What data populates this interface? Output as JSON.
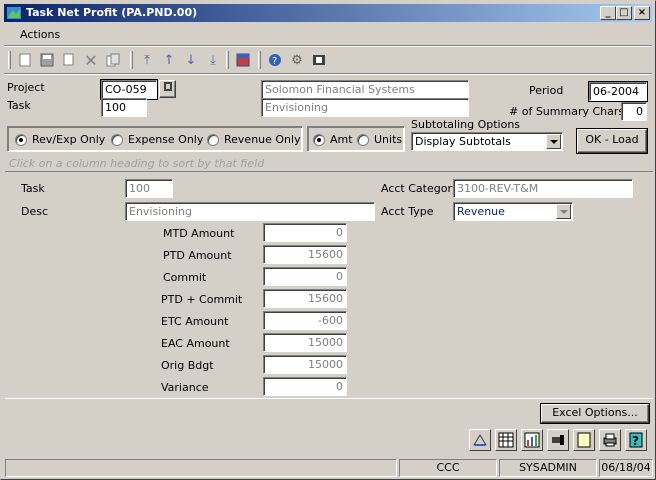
{
  "window": {
    "title": "Task Net Profit (PA.PND.00)"
  },
  "menu": {
    "actions_label": "Actions"
  },
  "toolbar": {
    "icons": [
      "new-icon",
      "save-icon",
      "copy-icon",
      "delete-icon",
      "cancel-icon",
      "first-icon",
      "previous-icon",
      "next-icon",
      "last-icon",
      "template-icon",
      "help-icon",
      "customize-icon",
      "quick-query-icon"
    ]
  },
  "header": {
    "project_label": "Project",
    "project_value": "CO-059",
    "project_desc": "Solomon Financial Systems",
    "task_label": "Task",
    "task_value": "100",
    "task_desc": "Envisioning",
    "period_label": "Period",
    "period_value": "06-2004",
    "summary_chars_label": "# of Summary Chars",
    "summary_chars_value": "0"
  },
  "options": {
    "radio_revexp": "Rev/Exp Only",
    "radio_expense": "Expense Only",
    "radio_revenue": "Revenue Only",
    "radio_amt": "Amt",
    "radio_units": "Units",
    "subtotaling_label": "Subtotaling Options",
    "subtotaling_value": "Display Subtotals",
    "ok_load": "OK - Load"
  },
  "hint": "Click on a column heading to sort by that field",
  "detail": {
    "task_label": "Task",
    "task_value": "100",
    "desc_label": "Desc",
    "desc_value": "Envisioning",
    "acct_category_label": "Acct Category",
    "acct_category_value": "3100-REV-T&M",
    "acct_type_label": "Acct Type",
    "acct_type_value": "Revenue",
    "amounts": [
      {
        "label": "MTD Amount",
        "value": "0"
      },
      {
        "label": "PTD Amount",
        "value": "15600"
      },
      {
        "label": "Commit",
        "value": "0"
      },
      {
        "label": "PTD + Commit",
        "value": "15600"
      },
      {
        "label": "ETC Amount",
        "value": "-600"
      },
      {
        "label": "EAC Amount",
        "value": "15000"
      },
      {
        "label": "Orig Bdgt",
        "value": "15000"
      },
      {
        "label": "Variance",
        "value": "0"
      }
    ]
  },
  "excel_options": "Excel Options...",
  "status": {
    "company": "CCC",
    "user": "SYSADMIN",
    "date": "06/18/04"
  }
}
